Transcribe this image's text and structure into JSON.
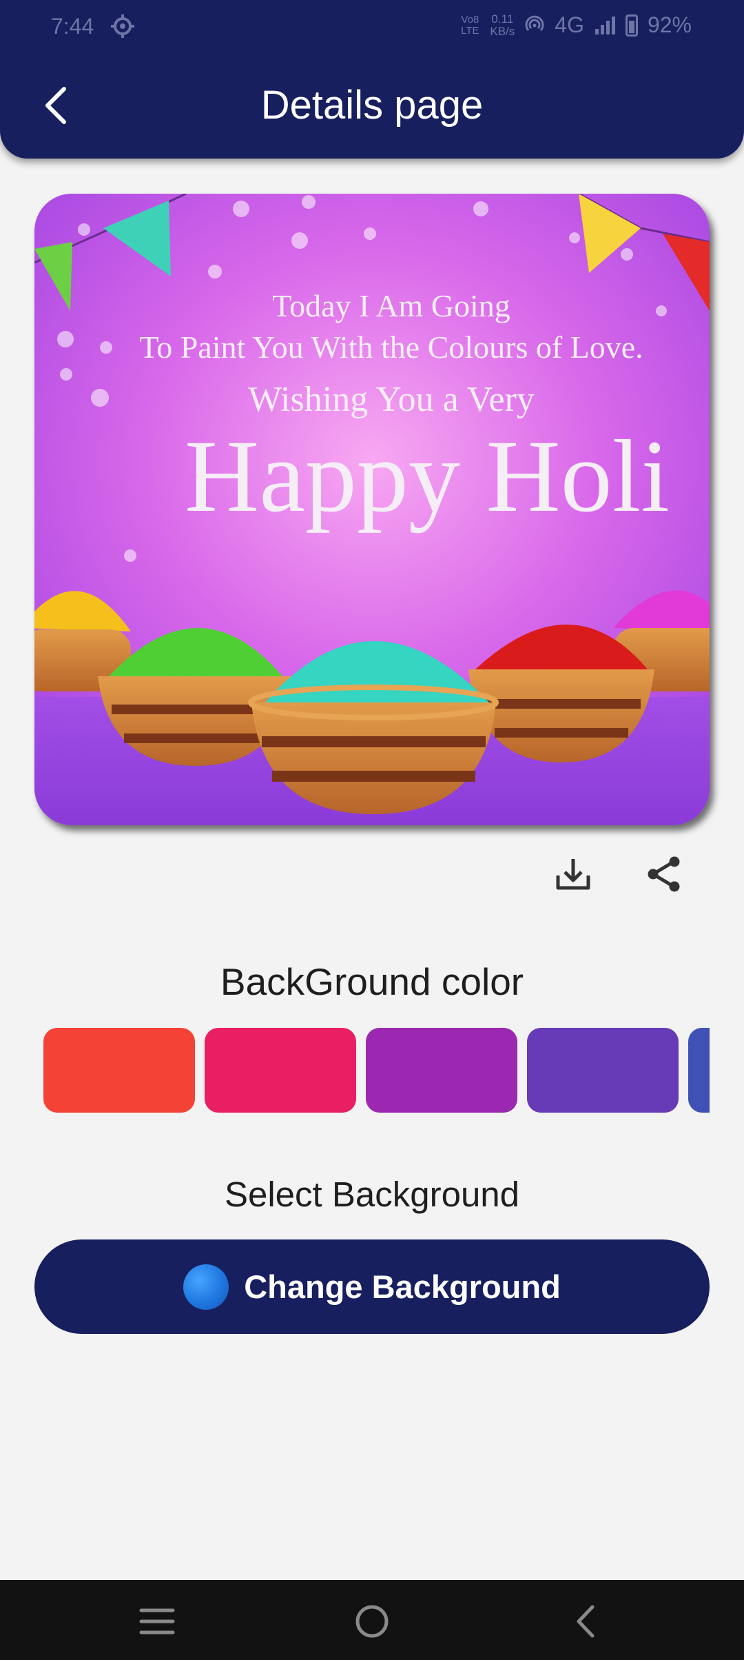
{
  "status_bar": {
    "time": "7:44",
    "volte": "Vo8 LTE",
    "speed_value": "0.11",
    "speed_unit": "KB/s",
    "network": "4G",
    "battery": "92%"
  },
  "app_bar": {
    "title": "Details page",
    "back_icon": "chevron-left-icon"
  },
  "card": {
    "line1": "Today I Am Going",
    "line2": "To Paint You With the Colours of Love.",
    "line3": "Wishing You a Very",
    "headline": "Happy Holi"
  },
  "actions": {
    "download_icon": "download-icon",
    "share_icon": "share-icon"
  },
  "background_color": {
    "label": "BackGround color",
    "swatches": [
      "#f44336",
      "#e91e63",
      "#9c27b0",
      "#673ab7",
      "#3f51b5"
    ]
  },
  "select_background": {
    "label": "Select Background",
    "button_label": "Change Background"
  },
  "nav_bar": {
    "menu_icon": "menu-icon",
    "home_icon": "home-circle-icon",
    "back_icon": "back-chevron-icon"
  }
}
